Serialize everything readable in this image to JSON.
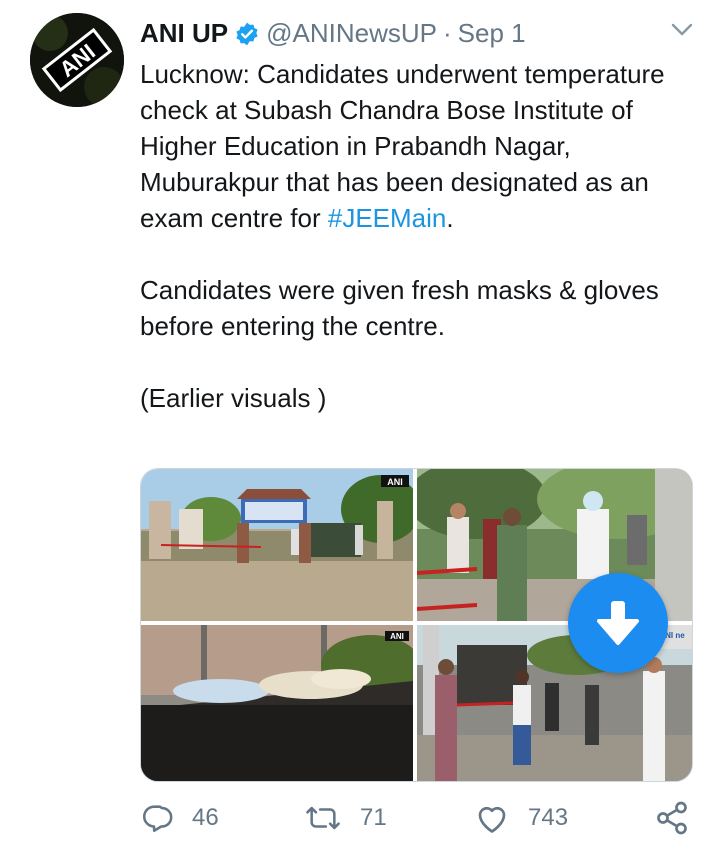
{
  "author": {
    "name": "ANI UP",
    "handle": "@ANINewsUP",
    "separator": "·",
    "date": "Sep 1",
    "logo_text": "ANI"
  },
  "tweet": {
    "text_part1": "Lucknow: Candidates underwent temperature check at Subash Chandra Bose Institute of Higher Education in Prabandh Nagar, Muburakpur that has been designated as an exam centre for ",
    "hashtag": "#JEEMain",
    "text_part1_end": ".",
    "paragraph2": "Candidates were given fresh masks & gloves before entering the centre.",
    "paragraph3": "(Earlier visuals )"
  },
  "media": {
    "watermark": "ANI",
    "watermark_partial": "ANI ne"
  },
  "actions": {
    "replies": "46",
    "retweets": "71",
    "likes": "743"
  },
  "colors": {
    "accent": "#1da1f2",
    "link": "#1b95e0",
    "muted": "#657786",
    "download_button": "#1d8cf0"
  },
  "icons": [
    "verified-badge-icon",
    "chevron-down-icon",
    "download-icon",
    "reply-icon",
    "retweet-icon",
    "like-icon",
    "share-icon"
  ]
}
